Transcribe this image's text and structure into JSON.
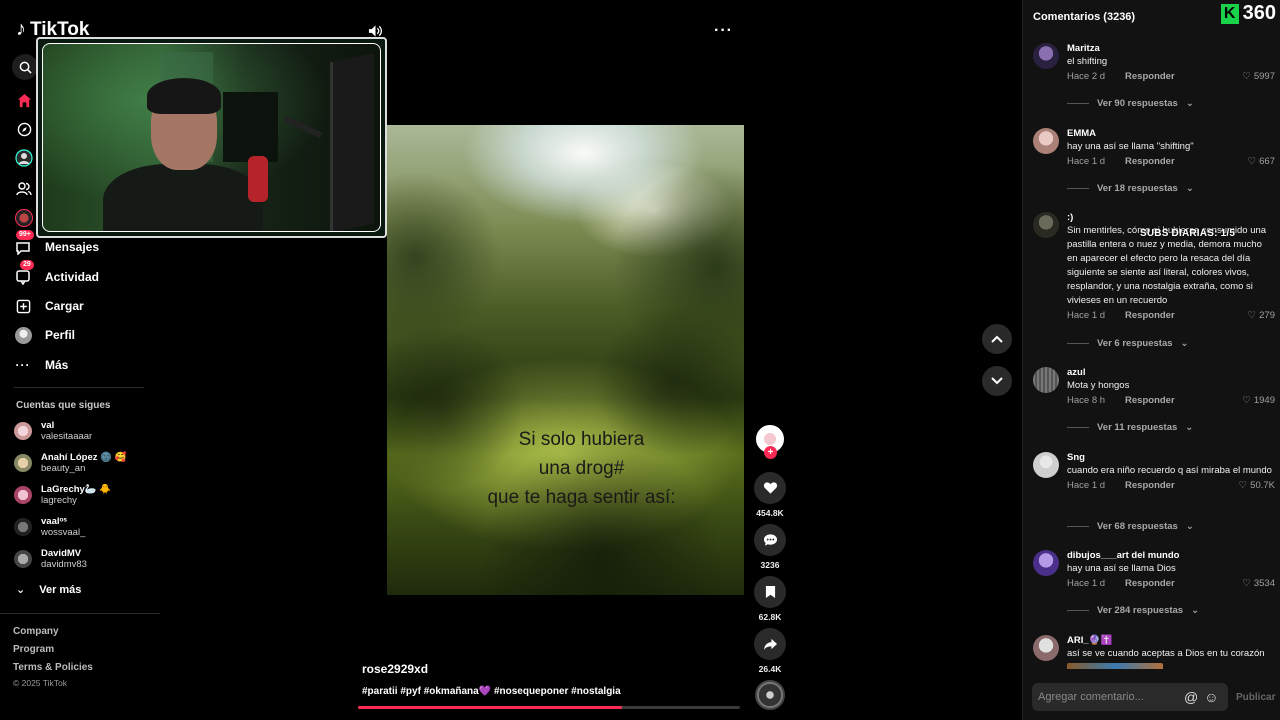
{
  "app": {
    "logo_text": "TikTok"
  },
  "sidebar": {
    "items": [
      {
        "label": "Mensajes",
        "badge": "99+"
      },
      {
        "label": "Actividad",
        "badge": "29"
      },
      {
        "label": "Cargar"
      },
      {
        "label": "Perfil"
      },
      {
        "label": "Más"
      }
    ],
    "following_title": "Cuentas que sigues",
    "following": [
      {
        "name": "val",
        "handle": "valesitaaaar"
      },
      {
        "name": "Anahí López 🌚 🥰",
        "handle": "beauty_an"
      },
      {
        "name": "LaGrechy🦢 🐥",
        "handle": "lagrechy"
      },
      {
        "name": "vaalᵒˢ",
        "handle": "wossvaal_"
      },
      {
        "name": "DavidMV",
        "handle": "davidmv83"
      }
    ],
    "see_more": "Ver más",
    "footer": [
      "Company",
      "Program",
      "Terms & Policies"
    ],
    "copyright": "© 2025 TikTok"
  },
  "video": {
    "text_lines": [
      "Si solo  hubiera",
      "una drog#",
      "que te haga sentir así:"
    ],
    "author": "rose2929xd",
    "caption": "#paratii #pyf #okmañana💜 #nosequeponer #nostalgia",
    "progress": 0.69
  },
  "actions": {
    "likes": "454.8K",
    "comments": "3236",
    "saves": "62.8K",
    "shares": "26.4K"
  },
  "comments": {
    "title": "Comentarios (3236)",
    "brand_number": "360",
    "overlay": "SUBS DIARIAS: 1/5",
    "respond_label": "Responder",
    "items": [
      {
        "user": "Maritza",
        "text": "el shifting",
        "time": "Hace 2 d",
        "likes": "5997",
        "replies": "Ver 90 respuestas"
      },
      {
        "user": "EMMA",
        "text": "hay una así se llama \"shifting\"",
        "time": "Hace 1 d",
        "likes": "667",
        "replies": "Ver 18 respuestas"
      },
      {
        "user": ":)",
        "text": "Sin mentirles, cómo si hubieras consumido una pastilla entera o nuez y media, demora mucho en aparecer el efecto pero la resaca del día siguiente se siente así literal, colores vivos, resplandor, y una nostalgia extraña, como si vivieses en un recuerdo",
        "time": "Hace 1 d",
        "likes": "279",
        "replies": "Ver 6 respuestas"
      },
      {
        "user": "azul",
        "text": "Mota y hongos",
        "time": "Hace 8 h",
        "likes": "1949",
        "replies": "Ver 11 respuestas"
      },
      {
        "user": "Sng",
        "text": "cuando era niño recuerdo q así miraba el mundo",
        "time": "Hace 1 d",
        "likes": "50.7K",
        "replies": "Ver 68 respuestas"
      },
      {
        "user": "dibujos___art del mundo",
        "text": "hay una así se llama Dios",
        "time": "Hace 1 d",
        "likes": "3534",
        "replies": "Ver 284 respuestas"
      },
      {
        "user": "ARI_🔮✝️",
        "text": "así se ve cuando aceptas a Dios en tu corazón",
        "time": "",
        "likes": "",
        "replies": ""
      }
    ],
    "input_placeholder": "Agregar comentario...",
    "publish_label": "Publicar"
  },
  "colors": {
    "accent": "#fe2c55",
    "panel_bg": "#121212",
    "brand_green": "#19d34a"
  }
}
